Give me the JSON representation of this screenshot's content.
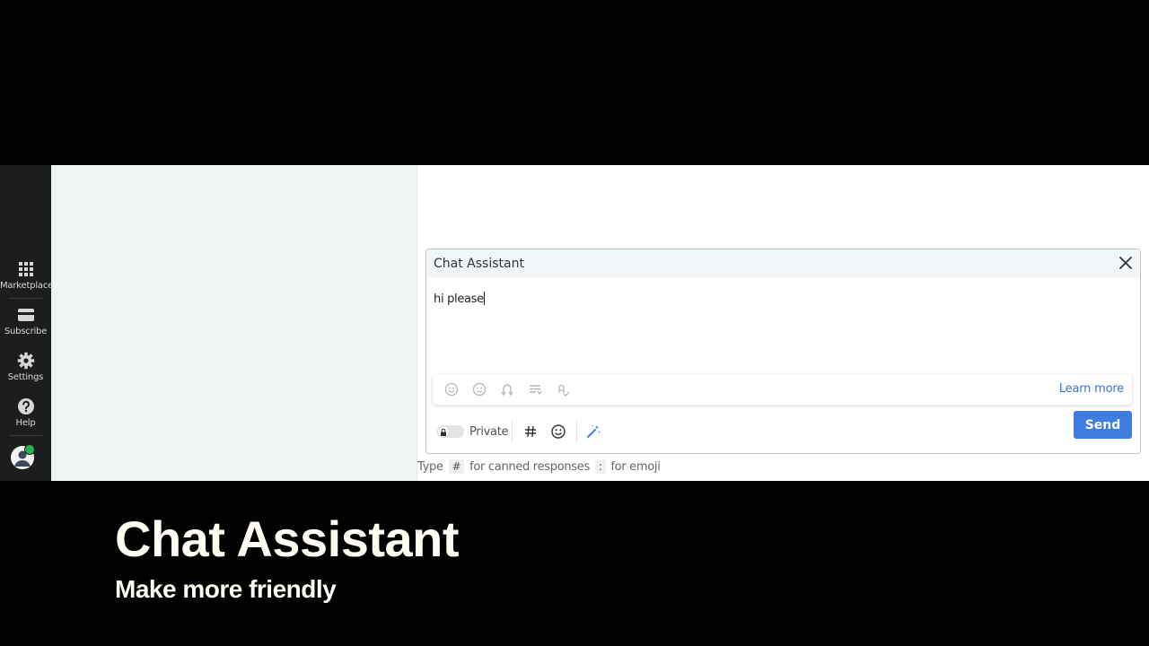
{
  "sidebar": {
    "items": [
      {
        "label": "Marketplace",
        "icon": "grid-icon"
      },
      {
        "label": "Subscribe",
        "icon": "card-icon"
      },
      {
        "label": "Settings",
        "icon": "gear-icon"
      },
      {
        "label": "Help",
        "icon": "help-icon"
      }
    ],
    "avatar_status_color": "#26b14b"
  },
  "dialog": {
    "title": "Chat Assistant",
    "editor_text": "hi please",
    "assist_icons": [
      "smile-icon",
      "neutral-face-icon",
      "rephrase-icon",
      "list-icon",
      "spell-check-icon"
    ],
    "learn_more": "Learn more"
  },
  "toolbar": {
    "private_label": "Private",
    "send_label": "Send",
    "accent_color": "#3e7cdf"
  },
  "hint": {
    "type": "Type",
    "hash_key": "#",
    "canned": "for canned responses",
    "colon_key": ":",
    "emoji": "for emoji"
  },
  "caption": {
    "title": "Chat Assistant",
    "subtitle": "Make more friendly"
  }
}
